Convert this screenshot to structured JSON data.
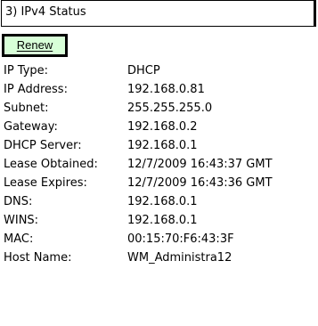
{
  "status_dropdown": {
    "selected": "3) IPv4 Status"
  },
  "renew_button": {
    "label": "Renew"
  },
  "info_rows": [
    {
      "label": "IP Type:",
      "value": "DHCP"
    },
    {
      "label": "IP Address:",
      "value": "192.168.0.81"
    },
    {
      "label": "Subnet:",
      "value": "255.255.255.0"
    },
    {
      "label": "Gateway:",
      "value": "192.168.0.2"
    },
    {
      "label": "DHCP Server:",
      "value": "192.168.0.1"
    },
    {
      "label": "Lease Obtained:",
      "value": "12/7/2009 16:43:37 GMT"
    },
    {
      "label": "Lease Expires:",
      "value": "12/7/2009 16:43:36 GMT"
    },
    {
      "label": "DNS:",
      "value": "192.168.0.1"
    },
    {
      "label": "WINS:",
      "value": "192.168.0.1"
    },
    {
      "label": "MAC:",
      "value": "00:15:70:F6:43:3F"
    },
    {
      "label": "Host Name:",
      "value": "WM_Administra12"
    }
  ]
}
